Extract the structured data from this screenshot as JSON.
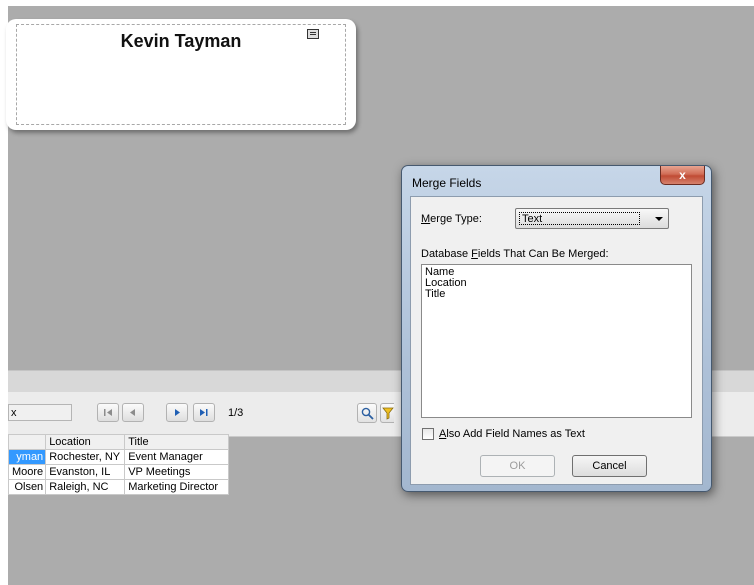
{
  "card": {
    "name": "Kevin Tayman"
  },
  "toolbar": {
    "search_value": "x",
    "page_indicator": "1/3",
    "buttons": [
      "first-record",
      "previous-record",
      "next-record",
      "last-record"
    ],
    "tools": [
      "magnifier-icon",
      "filter-icon"
    ]
  },
  "grid": {
    "columns": [
      "",
      "Location",
      "Title"
    ],
    "rows": [
      [
        "yman",
        "Rochester, NY",
        "Event Manager"
      ],
      [
        "Moore",
        "Evanston, IL",
        "VP Meetings"
      ],
      [
        "Olsen",
        "Raleigh, NC",
        "Marketing Director"
      ]
    ]
  },
  "dialog": {
    "title": "Merge Fields",
    "close_glyph": "x",
    "merge_type_label_prefix": "M",
    "merge_type_label_rest": "erge Type:",
    "merge_type_value": "Text",
    "fields_label_pre": "Database ",
    "fields_label_key": "F",
    "fields_label_post": "ields That Can Be Merged:",
    "fields": [
      "Name",
      "Location",
      "Title"
    ],
    "checkbox_label_key": "A",
    "checkbox_label_rest": "lso Add Field Names as Text",
    "checkbox_checked": false,
    "ok_label": "OK",
    "cancel_label": "Cancel"
  }
}
